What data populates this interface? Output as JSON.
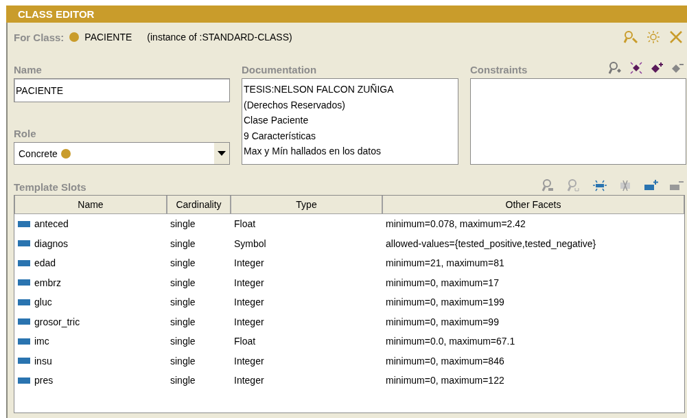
{
  "window": {
    "title": "CLASS EDITOR"
  },
  "for_class": {
    "label": "For Class:",
    "name": "PACIENTE",
    "instance_of": "(instance of :STANDARD-CLASS)"
  },
  "name_field": {
    "label": "Name",
    "value": "PACIENTE"
  },
  "role": {
    "label": "Role",
    "value": "Concrete"
  },
  "documentation": {
    "label": "Documentation",
    "lines": [
      "TESIS:NELSON FALCON ZUÑIGA",
      "(Derechos Reservados)",
      "Clase Paciente",
      "9 Características",
      "Max y Mín hallados en los datos"
    ]
  },
  "constraints": {
    "label": "Constraints"
  },
  "template_slots": {
    "label": "Template Slots",
    "columns": [
      "Name",
      "Cardinality",
      "Type",
      "Other Facets"
    ],
    "rows": [
      {
        "name": "anteced",
        "cardinality": "single",
        "type": "Float",
        "facets": "minimum=0.078, maximum=2.42"
      },
      {
        "name": "diagnos",
        "cardinality": "single",
        "type": "Symbol",
        "facets": "allowed-values={tested_positive,tested_negative}"
      },
      {
        "name": "edad",
        "cardinality": "single",
        "type": "Integer",
        "facets": "minimum=21, maximum=81"
      },
      {
        "name": "embrz",
        "cardinality": "single",
        "type": "Integer",
        "facets": "minimum=0, maximum=17"
      },
      {
        "name": "gluc",
        "cardinality": "single",
        "type": "Integer",
        "facets": "minimum=0, maximum=199"
      },
      {
        "name": "grosor_tric",
        "cardinality": "single",
        "type": "Integer",
        "facets": "minimum=0, maximum=99"
      },
      {
        "name": "imc",
        "cardinality": "single",
        "type": "Float",
        "facets": "minimum=0.0, maximum=67.1"
      },
      {
        "name": "insu",
        "cardinality": "single",
        "type": "Integer",
        "facets": "minimum=0, maximum=846"
      },
      {
        "name": "pres",
        "cardinality": "single",
        "type": "Integer",
        "facets": "minimum=0, maximum=122"
      }
    ]
  }
}
